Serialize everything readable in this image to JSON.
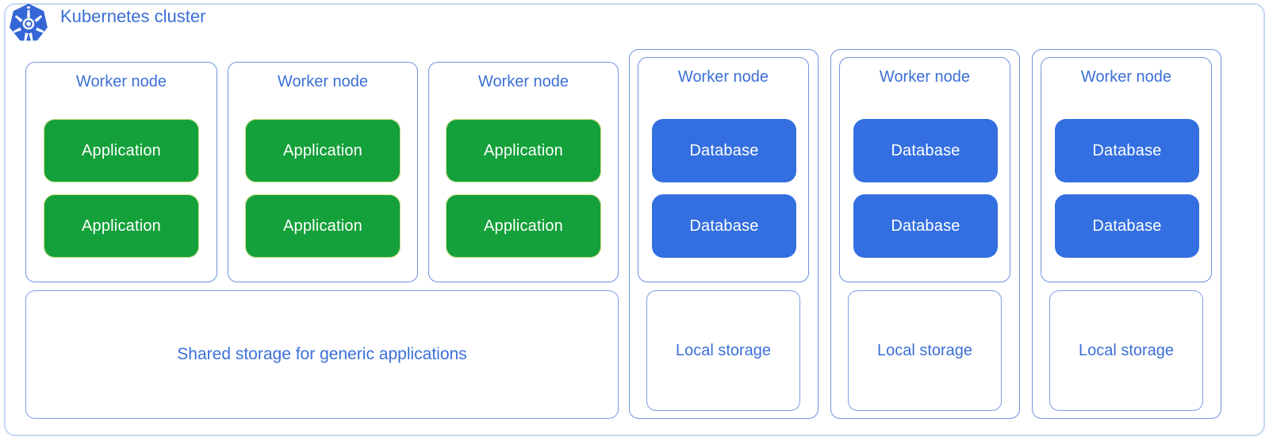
{
  "cluster": {
    "title": "Kubernetes cluster",
    "logo_icon": "kubernetes-helm-wheel-icon",
    "border_color": "#c6d8f5",
    "accent_color": "#3b6fd6"
  },
  "palette": {
    "application_green": "#14a03a",
    "database_blue": "#336fe0",
    "label_blue": "#3b6fd6",
    "outline_blue": "#6e93e0",
    "background": "#ffffff"
  },
  "app_group": {
    "nodes": [
      {
        "title": "Worker node",
        "workloads": [
          {
            "label": "Application",
            "kind": "app"
          },
          {
            "label": "Application",
            "kind": "app"
          }
        ]
      },
      {
        "title": "Worker node",
        "workloads": [
          {
            "label": "Application",
            "kind": "app"
          },
          {
            "label": "Application",
            "kind": "app"
          }
        ]
      },
      {
        "title": "Worker node",
        "workloads": [
          {
            "label": "Application",
            "kind": "app"
          },
          {
            "label": "Application",
            "kind": "app"
          }
        ]
      }
    ],
    "shared_storage": {
      "label": "Shared storage for generic applications"
    }
  },
  "db_groups": [
    {
      "node": {
        "title": "Worker node",
        "workloads": [
          {
            "label": "Database",
            "kind": "db"
          },
          {
            "label": "Database",
            "kind": "db"
          }
        ]
      },
      "storage": {
        "label": "Local storage"
      }
    },
    {
      "node": {
        "title": "Worker node",
        "workloads": [
          {
            "label": "Database",
            "kind": "db"
          },
          {
            "label": "Database",
            "kind": "db"
          }
        ]
      },
      "storage": {
        "label": "Local storage"
      }
    },
    {
      "node": {
        "title": "Worker node",
        "workloads": [
          {
            "label": "Database",
            "kind": "db"
          },
          {
            "label": "Database",
            "kind": "db"
          }
        ]
      },
      "storage": {
        "label": "Local storage"
      }
    }
  ]
}
